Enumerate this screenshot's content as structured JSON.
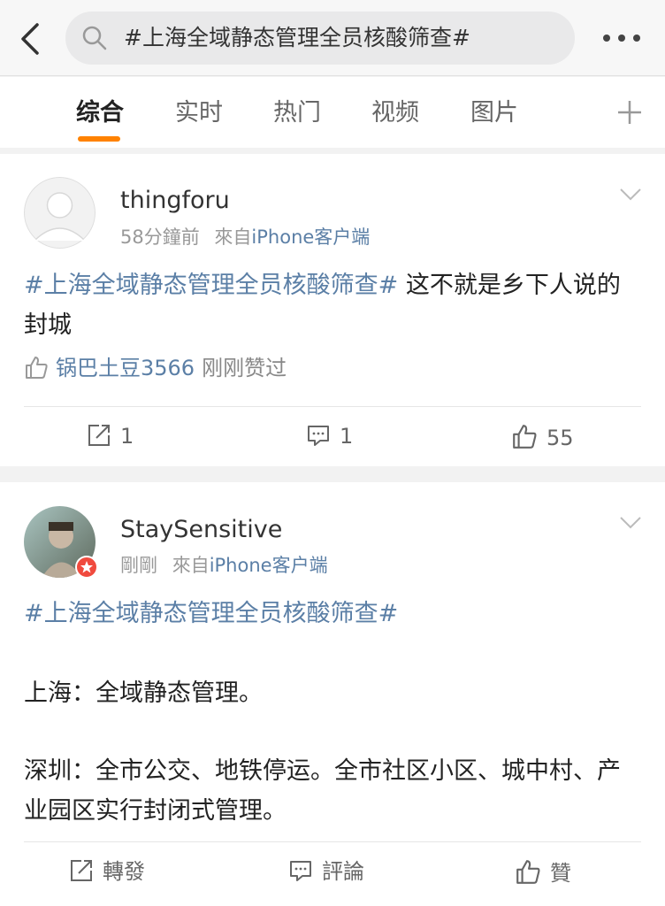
{
  "search": {
    "query": "#上海全域静态管理全员核酸筛查#"
  },
  "tabs": [
    {
      "label": "综合"
    },
    {
      "label": "实时"
    },
    {
      "label": "热门"
    },
    {
      "label": "视频"
    },
    {
      "label": "图片"
    }
  ],
  "colors": {
    "accent": "#ff8200",
    "link": "#5b7fa6",
    "badge": "#f04a3e"
  },
  "posts": [
    {
      "username": "thingforu",
      "time": "58分鐘前",
      "source_prefix": "來自",
      "source": "iPhone客户端",
      "hashtag": "#上海全域静态管理全员核酸筛查#",
      "text": " 这不就是乡下人说的封城",
      "liked_by": "锅巴土豆3566",
      "liked_action": "刚刚赞过",
      "repost_count": "1",
      "comment_count": "1",
      "like_count": "55"
    },
    {
      "username": "StaySensitive",
      "time": "剛剛",
      "source_prefix": "來自",
      "source": "iPhone客户端",
      "hashtag": "#上海全域静态管理全员核酸筛查#",
      "line1": "上海：全域静态管理。",
      "line2": "深圳：全市公交、地铁停运。全市社区小区、城中村、产业园区实行封闭式管理。",
      "repost_label": "轉發",
      "comment_label": "評論",
      "like_label": "贊"
    }
  ]
}
